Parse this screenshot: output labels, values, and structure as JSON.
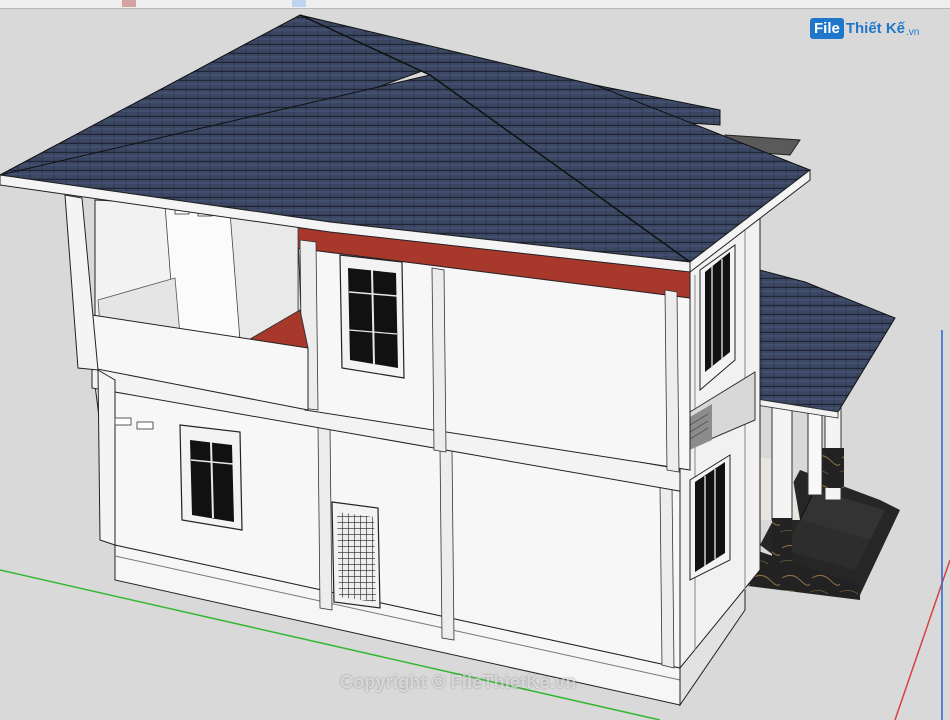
{
  "app": {
    "toolbar": {
      "buttons": [
        {
          "name": "select-tool-button",
          "icon": "arrow-icon"
        },
        {
          "name": "eraser-tool-button",
          "icon": "eraser-icon"
        },
        {
          "name": "line-tool-button",
          "icon": "pencil-icon"
        },
        {
          "name": "rectangle-tool-button",
          "icon": "rectangle-icon"
        },
        {
          "name": "circle-tool-button",
          "icon": "circle-icon"
        },
        {
          "name": "push-pull-tool-button",
          "icon": "push-pull-icon"
        },
        {
          "name": "move-tool-button",
          "icon": "move-icon"
        },
        {
          "name": "orbit-tool-button",
          "icon": "orbit-icon"
        },
        {
          "name": "zoom-tool-button",
          "icon": "zoom-icon"
        },
        {
          "name": "paint-tool-button",
          "icon": "paint-bucket-icon"
        }
      ]
    },
    "logo": {
      "badge": "File",
      "text": "Thiết Kế",
      "suffix": ".vn"
    },
    "watermark": "Copyright © FileThietKe.vn",
    "colors": {
      "background": "#d9d9d9",
      "roof": "#3b4763",
      "wall": "#f7f7f7",
      "accent_red": "#a8382c",
      "axis_green": "#35b835",
      "axis_red": "#d94040",
      "axis_blue": "#2a62d6",
      "logo_blue": "#1f77c9"
    }
  }
}
